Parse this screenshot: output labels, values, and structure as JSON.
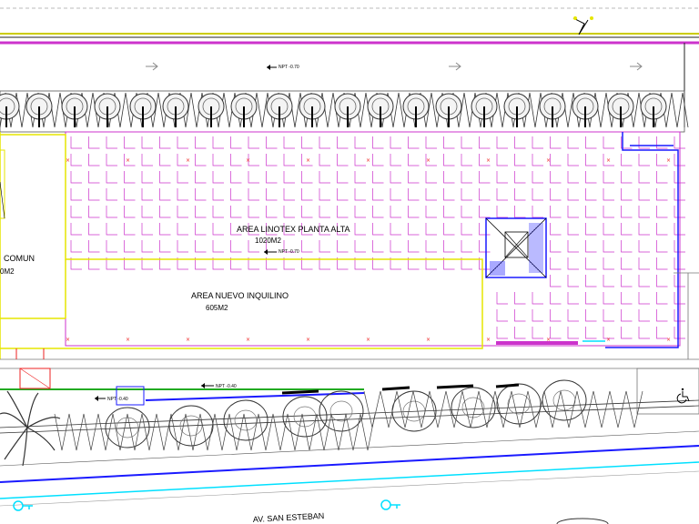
{
  "areas": {
    "linotex": {
      "name": "AREA LINOTEX PLANTA ALTA",
      "size": "1020M2"
    },
    "nuevo": {
      "name": "AREA NUEVO INQUILINO",
      "size": "605M2"
    },
    "comun": {
      "name": "COMUN",
      "size": "0M2"
    }
  },
  "street": "AV. SAN ESTEBAN",
  "levels": [
    "NPT -0.70",
    "NPT -0.70",
    "NPT -0.40",
    "NPT -0.40",
    "NPT -0.40"
  ],
  "colors": {
    "magenta": "#cc33cc",
    "yellow": "#e6e600",
    "blue": "#1a1aff",
    "cyan": "#00e0ff",
    "green": "#22aa22",
    "red": "#ee2222"
  }
}
